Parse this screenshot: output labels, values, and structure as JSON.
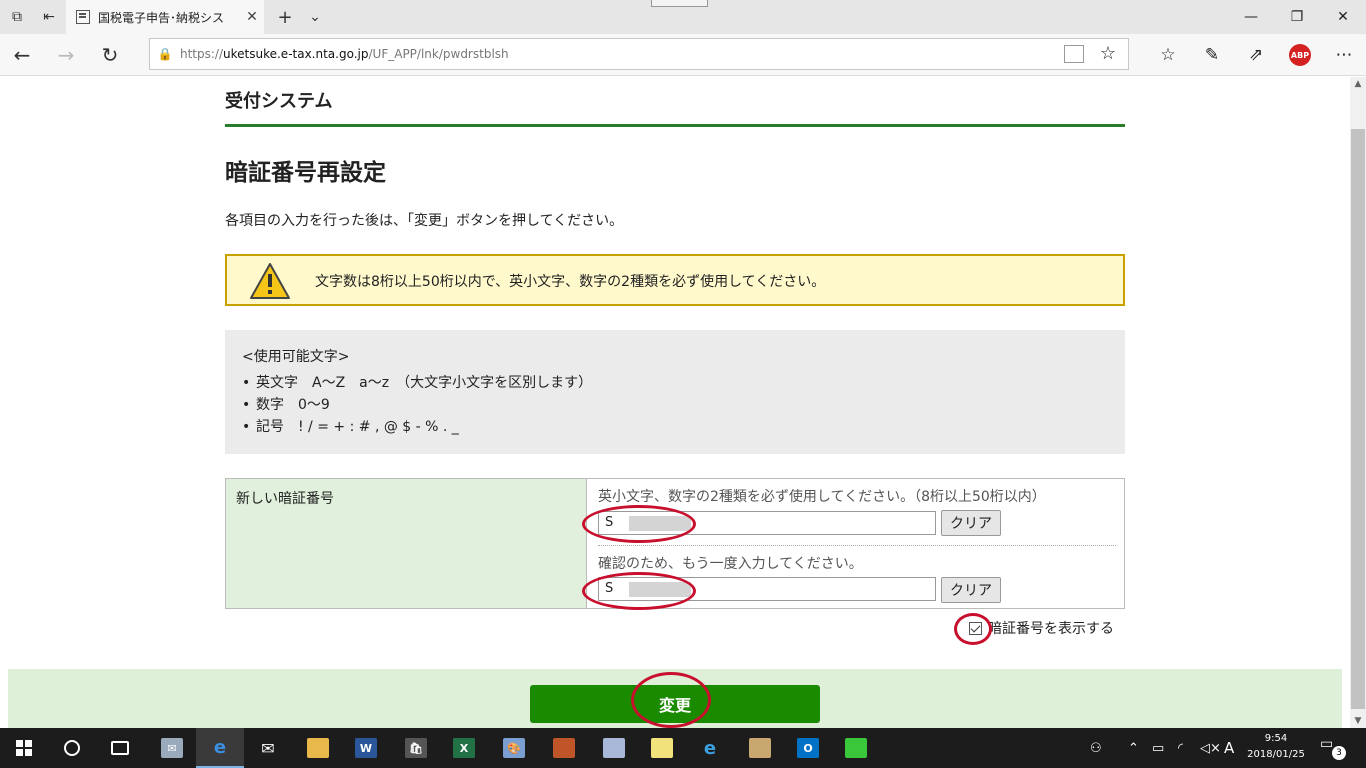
{
  "browser": {
    "tab_title": "国税電子申告･納税シス",
    "url_proto": "https://",
    "url_host": "uketsuke.e-tax.nta.go.jp",
    "url_path": "/UF_APP/lnk/pwdrstblsh",
    "abp_label": "ABP"
  },
  "page": {
    "site_title": "受付システム",
    "heading": "暗証番号再設定",
    "instruction": "各項目の入力を行った後は、「変更」ボタンを押してください。",
    "warning": "文字数は8桁以上50桁以内で、英小文字、数字の2種類を必ず使用してください。",
    "allowed_chars": {
      "header": "<使用可能文字>",
      "items": [
        "英文字　A～Z　a～z　（大文字小文字を区別します）",
        "数字　0～9",
        "記号　! / = + : # , @ $ - % . _"
      ]
    },
    "form": {
      "label": "新しい暗証番号",
      "hint1": "英小文字、数字の2種類を必ず使用してください。（8桁以上50桁以内）",
      "value1": "S",
      "clear1": "クリア",
      "hint2": "確認のため、もう一度入力してください。",
      "value2": "S",
      "clear2": "クリア",
      "show_password": "暗証番号を表示する",
      "show_password_checked": true
    },
    "submit": "変更"
  },
  "taskbar": {
    "time": "9:54",
    "date": "2018/01/25",
    "ime": "A",
    "notification_count": "3"
  },
  "icons": {
    "tab_actions": "tab-actions-icon",
    "warning": "warning-triangle-icon",
    "accent_colors": {
      "green": "#1a8a00",
      "highlight": "#c8102e"
    }
  }
}
